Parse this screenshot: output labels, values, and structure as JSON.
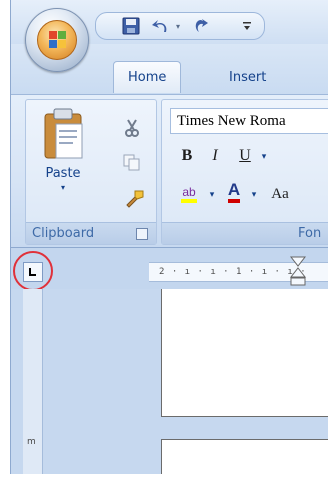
{
  "quick_access": {
    "save_icon": "save-icon",
    "undo_icon": "undo-icon",
    "redo_icon": "redo-icon",
    "customize_icon": "customize-dropdown-icon"
  },
  "office_button": {
    "icon": "office-logo-icon"
  },
  "tabs": [
    {
      "label": "Home",
      "active": true
    },
    {
      "label": "Insert",
      "active": false
    }
  ],
  "clipboard_group": {
    "label": "Clipboard",
    "paste_label": "Paste",
    "cut_icon": "scissors-icon",
    "copy_icon": "copy-icon",
    "format_painter_icon": "format-painter-icon",
    "launcher_icon": "dialog-launcher-icon"
  },
  "font_group": {
    "label": "Fon",
    "font_name": "Times New Roma",
    "bold_label": "B",
    "italic_label": "I",
    "underline_label": "U",
    "change_case_label": "Aa",
    "font_color_label": "A",
    "highlight_label": "ab"
  },
  "ruler": {
    "tab_selector_icon": "left-tab-stop-icon",
    "text": "2 · ı · ı · 1 · ı · ı ·",
    "vertical_mark": "m"
  },
  "colors": {
    "highlight_yellow": "#ffff00",
    "font_color_red": "#d00000",
    "annotation_red": "#e0313a"
  }
}
